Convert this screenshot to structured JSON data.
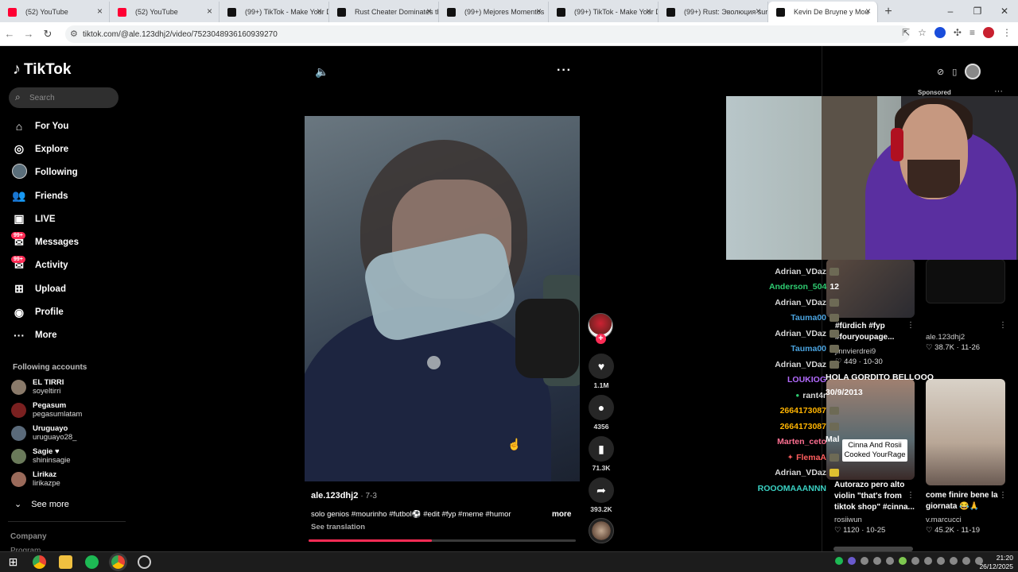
{
  "browser": {
    "tabs": [
      {
        "label": "(52) YouTube",
        "color": "#ff0033"
      },
      {
        "label": "(52) YouTube",
        "color": "#ff0033"
      },
      {
        "label": "(99+) TikTok - Make Your D",
        "color": "#111111"
      },
      {
        "label": "Rust Cheater Dominates th",
        "color": "#111111"
      },
      {
        "label": "(99+) Mejores Momentos",
        "color": "#111111"
      },
      {
        "label": "(99+) TikTok - Make Your D",
        "color": "#111111"
      },
      {
        "label": "(99+) Rust: Эволюция sur",
        "color": "#111111"
      },
      {
        "label": "Kevin De Bruyne y Mou",
        "color": "#111111"
      }
    ],
    "url": "tiktok.com/@ale.123dhj2/video/7523048936160939270"
  },
  "sidebar": {
    "logo": "TikTok",
    "search_placeholder": "Search",
    "nav": [
      {
        "label": "For You",
        "icon": "home-icon"
      },
      {
        "label": "Explore",
        "icon": "compass-icon"
      },
      {
        "label": "Following",
        "icon": "following-avatar-icon"
      },
      {
        "label": "Friends",
        "icon": "friends-icon"
      },
      {
        "label": "LIVE",
        "icon": "live-icon"
      },
      {
        "label": "Messages",
        "icon": "messages-icon",
        "badge": "99+"
      },
      {
        "label": "Activity",
        "icon": "activity-icon",
        "badge": "99+"
      },
      {
        "label": "Upload",
        "icon": "upload-icon"
      },
      {
        "label": "Profile",
        "icon": "profile-icon"
      },
      {
        "label": "More",
        "icon": "more-icon"
      }
    ],
    "following_title": "Following accounts",
    "accounts": [
      {
        "name": "EL TIRRI",
        "handle": "soyeltirri",
        "color": "#8a7a6a"
      },
      {
        "name": "Pegasum",
        "handle": "pegasumlatam",
        "color": "#7a2020"
      },
      {
        "name": "Uruguayo",
        "handle": "uruguayo28_",
        "color": "#5a6a7a"
      },
      {
        "name": "Sagie ♥",
        "handle": "shininsagie",
        "color": "#6a7a5a"
      },
      {
        "name": "Lirikaz",
        "handle": "lirikazpe",
        "color": "#9a6a5a"
      }
    ],
    "see_more": "See more",
    "company": "Company",
    "program": "Program"
  },
  "video": {
    "author": "ale.123dhj2",
    "date": "· 7-3",
    "caption": "solo genios #mourinho #futbol⚽ #edit #fyp #meme #humor",
    "more": "more",
    "see_translation": "See translation",
    "progress": 0.46
  },
  "actions": {
    "likes": "1.1M",
    "comments": "4356",
    "saves": "71.3K",
    "shares": "393.2K"
  },
  "right": {
    "sponsored": "Sponsored",
    "chat": [
      {
        "user": "Adrian_VDaz",
        "color": "#d8d8d8"
      },
      {
        "user": "Anderson_504",
        "color": "#2ecc71",
        "msg": "12"
      },
      {
        "user": "Adrian_VDaz",
        "color": "#d8d8d8"
      },
      {
        "user": "Tauma00",
        "color": "#4aa3df"
      },
      {
        "user": "Adrian_VDaz",
        "color": "#d8d8d8"
      },
      {
        "user": "Tauma00",
        "color": "#4aa3df"
      },
      {
        "user": "Adrian_VDaz",
        "color": "#d8d8d8"
      },
      {
        "user": "LOUKIOG",
        "color": "#b36bff",
        "msg": "HOLA GORDITO BELLOOO"
      },
      {
        "user": "rant4r",
        "color": "#d8d8d8",
        "msg": "30/9/2013"
      },
      {
        "user": "2664173087",
        "color": "#ffb400"
      },
      {
        "user": "2664173087",
        "color": "#ffb400"
      },
      {
        "user": "Marten_ceto",
        "color": "#ff6f91",
        "msg": "Mal"
      },
      {
        "user": "FlemaA",
        "color": "#ff5e5e"
      },
      {
        "user": "Adrian_VDaz",
        "color": "#d8d8d8"
      },
      {
        "user": "ROOOMAAANNN",
        "color": "#3ad1c3"
      }
    ],
    "cards": [
      {
        "title": "#fürdich #fyp #fouryoupage...",
        "author": "jinnvierdrei9",
        "likes": "449",
        "date": "10-30"
      },
      {
        "title": "",
        "author": "ale.123dhj2",
        "likes": "38.7K",
        "date": "11-26"
      },
      {
        "title": "Autorazo pero alto violin \"that's from tiktok shop\" #cinna...",
        "author": "rosiiwun",
        "likes": "1120",
        "date": "10-25",
        "overlay": "Cinna And Rosii Cooked YourRage"
      },
      {
        "title": "come finire bene la giornata 😂🙏",
        "author": "v.marcucci",
        "likes": "45.2K",
        "date": "11-19"
      }
    ]
  },
  "taskbar": {
    "time": "21:20",
    "date": "26/12/2025"
  }
}
